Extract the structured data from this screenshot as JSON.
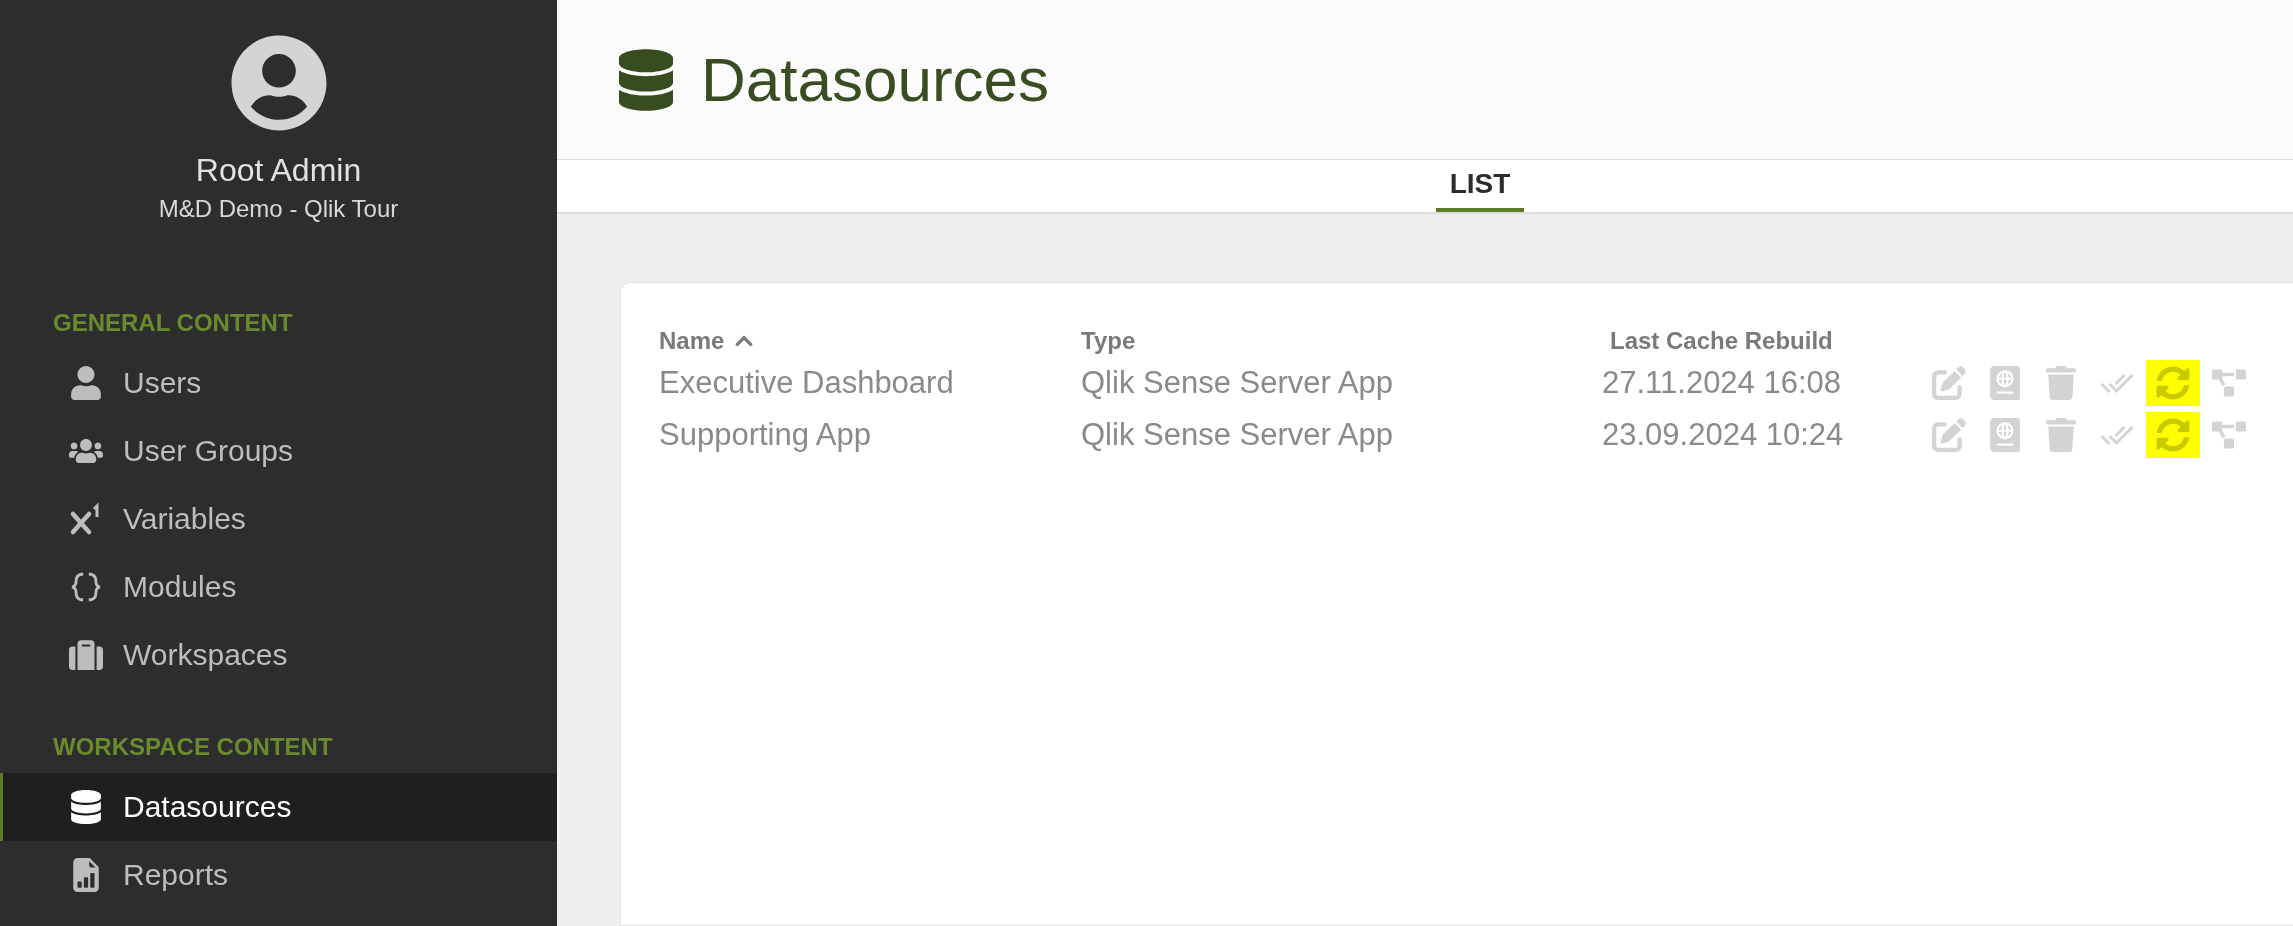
{
  "profile": {
    "name": "Root Admin",
    "subtitle": "M&D Demo - Qlik Tour"
  },
  "sidebar": {
    "sections": [
      {
        "heading": "GENERAL CONTENT",
        "items": [
          {
            "label": "Users",
            "kind": "user",
            "selected": false
          },
          {
            "label": "User Groups",
            "kind": "users",
            "selected": false
          },
          {
            "label": "Variables",
            "kind": "variable",
            "selected": false
          },
          {
            "label": "Modules",
            "kind": "braces",
            "selected": false
          },
          {
            "label": "Workspaces",
            "kind": "suitcase",
            "selected": false
          }
        ]
      },
      {
        "heading": "WORKSPACE CONTENT",
        "items": [
          {
            "label": "Datasources",
            "kind": "database",
            "selected": true
          },
          {
            "label": "Reports",
            "kind": "report",
            "selected": false
          }
        ]
      }
    ]
  },
  "page": {
    "title": "Datasources"
  },
  "tabs": [
    {
      "label": "LIST",
      "selected": true
    }
  ],
  "table": {
    "columns": [
      {
        "label": "Name",
        "sorted": true
      },
      {
        "label": "Type",
        "sorted": false
      },
      {
        "label": "Last Cache Rebuild",
        "sorted": false
      }
    ],
    "rows": [
      {
        "cells": [
          "Executive Dashboard",
          "Qlik Sense Server App",
          "27.11.2024 16:08"
        ],
        "actions": [
          {
            "kind": "edit",
            "highlighted": false
          },
          {
            "kind": "passport",
            "highlighted": false
          },
          {
            "kind": "delete",
            "highlighted": false
          },
          {
            "kind": "check",
            "highlighted": false
          },
          {
            "kind": "refresh",
            "highlighted": true
          },
          {
            "kind": "diagram",
            "highlighted": false
          }
        ]
      },
      {
        "cells": [
          "Supporting App",
          "Qlik Sense Server App",
          "23.09.2024 10:24"
        ],
        "actions": [
          {
            "kind": "edit",
            "highlighted": false
          },
          {
            "kind": "passport",
            "highlighted": false
          },
          {
            "kind": "delete",
            "highlighted": false
          },
          {
            "kind": "check",
            "highlighted": false
          },
          {
            "kind": "refresh",
            "highlighted": true
          },
          {
            "kind": "diagram",
            "highlighted": false
          }
        ]
      }
    ]
  }
}
